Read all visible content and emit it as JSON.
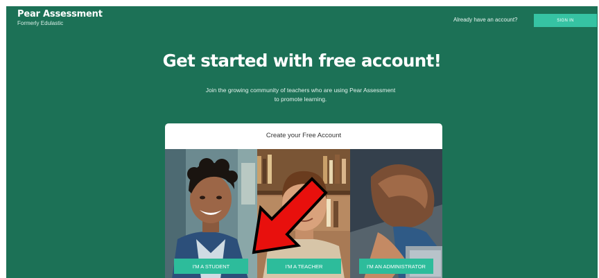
{
  "header": {
    "brand": "Pear Assessment",
    "brand_sub": "Formerly Edulastic",
    "account_prompt": "Already have an account?",
    "sign_in_label": "SIGN IN"
  },
  "hero": {
    "title": "Get started with free account!",
    "subtitle_line1": "Join the growing community of teachers who are using Pear Assessment",
    "subtitle_line2": "to promote learning."
  },
  "card": {
    "title": "Create your Free Account",
    "roles": [
      {
        "label": "I'M A STUDENT"
      },
      {
        "label": "I'M A TEACHER"
      },
      {
        "label": "I'M AN ADMINISTRATOR"
      }
    ]
  },
  "colors": {
    "background": "#1c7156",
    "accent": "#2dbc9b",
    "arrow": "#e8100d"
  }
}
